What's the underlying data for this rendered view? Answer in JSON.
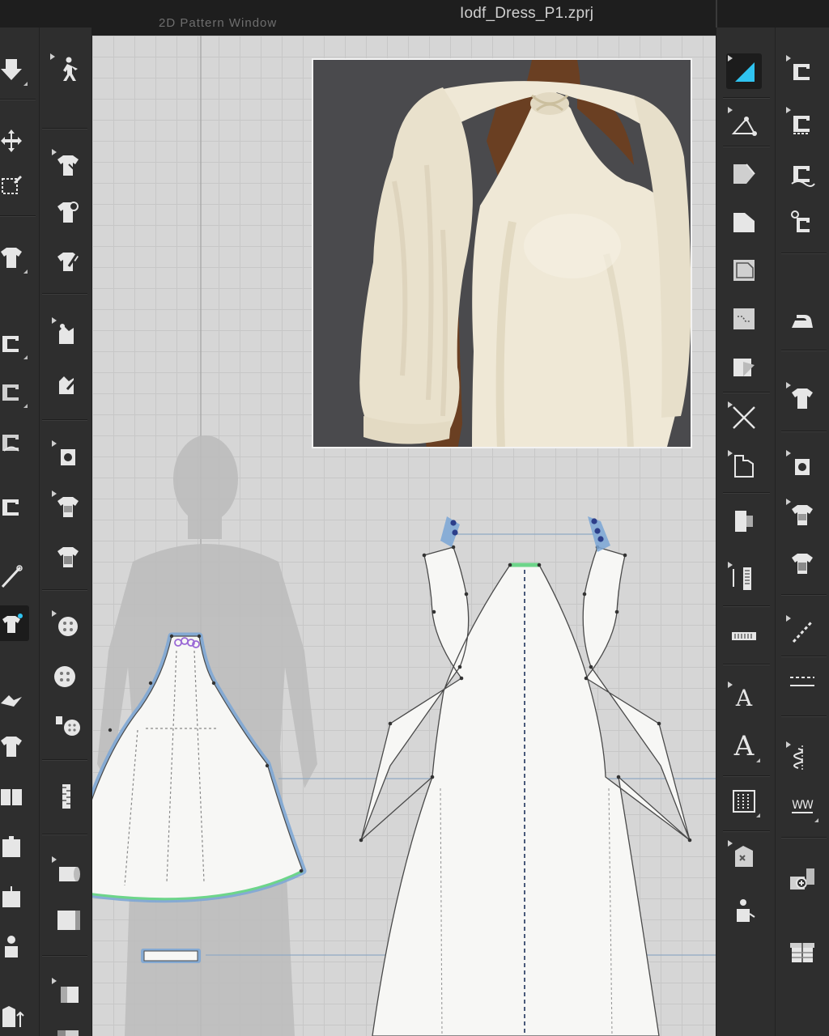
{
  "window": {
    "file_title": "Iodf_Dress_P1.zprj",
    "pattern_window_label": "2D Pattern Window"
  },
  "colors": {
    "toolbar_bg": "#2e2e2e",
    "canvas_bg": "#d6d6d6",
    "grid_line": "#c7c7c7",
    "pattern_fill": "#f7f7f5",
    "selection_outline": "#7aa6d6",
    "active_tool_accent": "#2fc3f0",
    "fabric": "#efe8d6",
    "skin": "#6a3f22",
    "preview_bg": "#4a4a4d"
  },
  "left_toolbar": {
    "tools": [
      {
        "id": "move-down-tool",
        "icon": "arrow-down-icon"
      },
      {
        "id": "walk-avatar-tool",
        "icon": "walking-avatar-icon"
      },
      {
        "id": "transform-tool",
        "icon": "move-cross-icon"
      },
      {
        "id": "shirt-arrow-tool",
        "icon": "shirt-select-icon"
      },
      {
        "id": "edit-point-tool",
        "icon": "edit-box-icon"
      },
      {
        "id": "shirt-pin-tool",
        "icon": "shirt-pin-icon"
      },
      {
        "id": "shirt-pencil-tool",
        "icon": "shirt-pencil-icon"
      },
      {
        "id": "shirt-settings-tool",
        "icon": "shirt-gear-icon"
      },
      {
        "id": "sew-tool",
        "icon": "sewing-machine-icon"
      },
      {
        "id": "fold-tool",
        "icon": "fold-arrow-icon"
      },
      {
        "id": "needle-tool",
        "icon": "needle-icon"
      },
      {
        "id": "button-tool",
        "icon": "button-icon"
      },
      {
        "id": "zipper-tool",
        "icon": "zipper-icon"
      },
      {
        "id": "fabric-roll-tool",
        "icon": "fabric-roll-icon"
      },
      {
        "id": "avatar-tool",
        "icon": "avatar-icon"
      }
    ]
  },
  "right_toolbar": {
    "tools": [
      {
        "id": "select-mesh-tool",
        "icon": "triangle-select-icon",
        "active": true
      },
      {
        "id": "segment-sew-tool",
        "icon": "sew-segment-icon"
      },
      {
        "id": "edit-pattern-tool",
        "icon": "edit-pattern-icon"
      },
      {
        "id": "free-sew-tool",
        "icon": "free-sew-icon"
      },
      {
        "id": "polygon-tool",
        "icon": "polygon-icon"
      },
      {
        "id": "tack-tool",
        "icon": "tack-icon"
      },
      {
        "id": "rectangle-tool",
        "icon": "rectangle-icon"
      },
      {
        "id": "iron-tool",
        "icon": "iron-icon"
      },
      {
        "id": "internal-polygon-tool",
        "icon": "internal-polygon-icon"
      },
      {
        "id": "texture-tool",
        "icon": "texture-shirt-icon"
      },
      {
        "id": "cut-tool",
        "icon": "scissors-line-icon"
      },
      {
        "id": "sleeve-tool",
        "icon": "sleeve-icon"
      },
      {
        "id": "trace-tool",
        "icon": "trace-icon"
      },
      {
        "id": "pleat-tool",
        "icon": "pleat-icon"
      },
      {
        "id": "dart-tool",
        "icon": "dart-icon"
      },
      {
        "id": "line-sew-tool",
        "icon": "line-sew-icon"
      },
      {
        "id": "ruler-tool",
        "icon": "ruler-icon"
      },
      {
        "id": "stitch-tool",
        "icon": "stitch-icon"
      },
      {
        "id": "text-tool",
        "icon": "text-a-icon",
        "glyph": "A"
      },
      {
        "id": "topstitch-tool",
        "icon": "topstitch-icon"
      },
      {
        "id": "text-edit-tool",
        "icon": "text-edit-icon",
        "glyph": "A"
      },
      {
        "id": "elastic-tool",
        "icon": "elastic-icon",
        "glyph": "WW"
      },
      {
        "id": "grading-tool",
        "icon": "grading-icon"
      },
      {
        "id": "add-trim-tool",
        "icon": "add-trim-icon"
      },
      {
        "id": "puckering-tool",
        "icon": "puckering-icon"
      },
      {
        "id": "gift-tool",
        "icon": "gift-box-icon"
      },
      {
        "id": "figure-tool",
        "icon": "figure-icon"
      }
    ]
  }
}
